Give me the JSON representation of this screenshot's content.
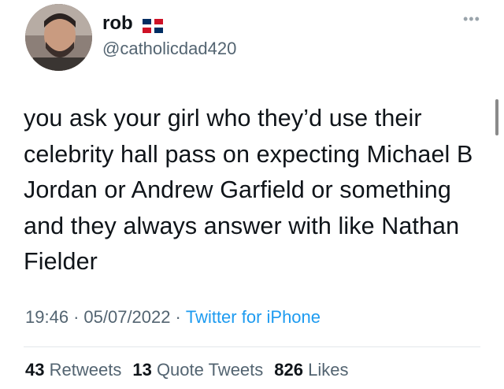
{
  "user": {
    "name": "rob",
    "handle": "@catholicdad420",
    "flag_icon": "dominican-republic-flag-icon"
  },
  "tweet": {
    "text": "you ask your girl who they’d use their celebrity hall pass on expecting Michael B Jordan or Andrew Garfield or something and they always answer with like Nathan Fielder",
    "time": "19:46",
    "date": "05/07/2022",
    "separator": "·",
    "source": "Twitter for iPhone"
  },
  "stats": {
    "retweets_count": "43",
    "retweets_label": "Retweets",
    "quotes_count": "13",
    "quotes_label": "Quote Tweets",
    "likes_count": "826",
    "likes_label": "Likes"
  },
  "more_icon": "more-options-icon",
  "colors": {
    "text": "#0f1419",
    "secondary": "#536471",
    "link": "#1d9bf0",
    "divider": "#e3e7ea"
  }
}
